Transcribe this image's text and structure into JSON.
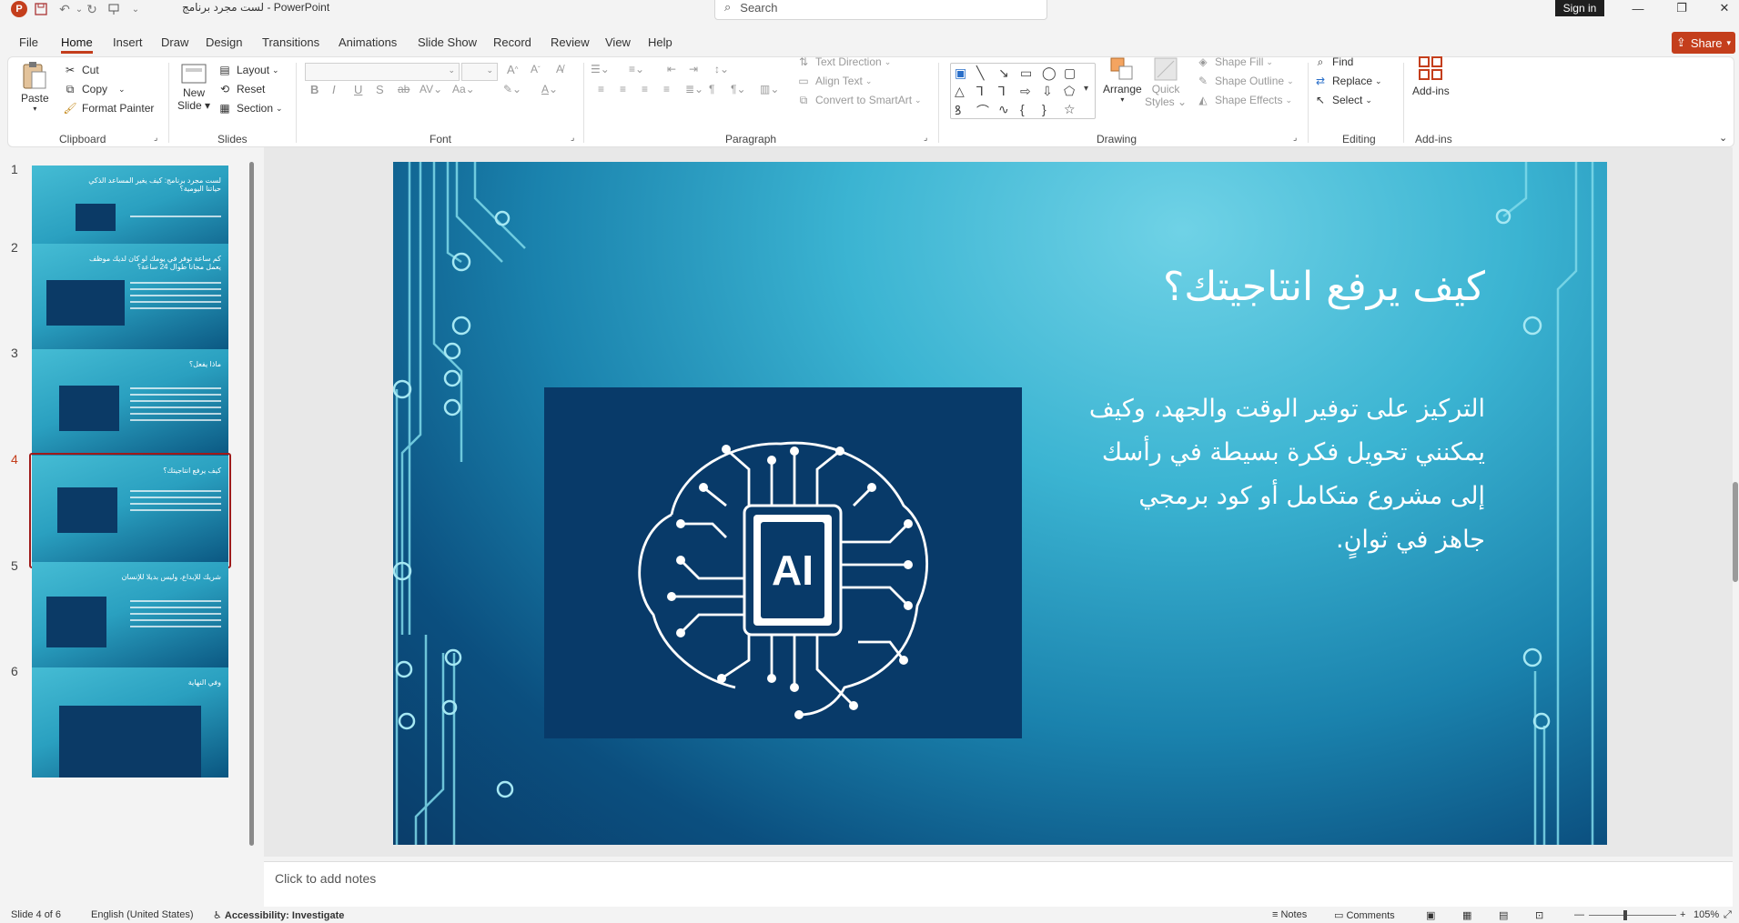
{
  "titlebar": {
    "doc_title": "لست مجرد برنامج",
    "separator": "-",
    "app_name": "PowerPoint",
    "search_placeholder": "Search",
    "sign_in": "Sign in"
  },
  "menu": [
    "File",
    "Home",
    "Insert",
    "Draw",
    "Design",
    "Transitions",
    "Animations",
    "Slide Show",
    "Record",
    "Review",
    "View",
    "Help"
  ],
  "active_menu": "Home",
  "share_label": "Share",
  "ribbon": {
    "clipboard": {
      "paste": "Paste",
      "cut": "Cut",
      "copy": "Copy",
      "format_painter": "Format Painter",
      "label": "Clipboard"
    },
    "slides": {
      "new_slide_1": "New",
      "new_slide_2": "Slide",
      "layout": "Layout",
      "reset": "Reset",
      "section": "Section",
      "label": "Slides"
    },
    "font": {
      "label": "Font"
    },
    "paragraph": {
      "text_direction": "Text Direction",
      "align_text": "Align Text",
      "convert_smartart": "Convert to SmartArt",
      "label": "Paragraph"
    },
    "drawing": {
      "arrange": "Arrange",
      "quick_styles_1": "Quick",
      "quick_styles_2": "Styles",
      "shape_fill": "Shape Fill",
      "shape_outline": "Shape Outline",
      "shape_effects": "Shape Effects",
      "label": "Drawing"
    },
    "editing": {
      "find": "Find",
      "replace": "Replace",
      "select": "Select",
      "label": "Editing"
    },
    "addins": {
      "button": "Add-ins",
      "label": "Add-ins"
    }
  },
  "slides": [
    {
      "num": "1",
      "title": "لست مجرد برنامج: كيف يغير المساعد الذكي حياتنا اليومية؟"
    },
    {
      "num": "2",
      "title": "كم ساعة توفر في يومك لو كان لديك موظف يعمل مجانا طوال 24 ساعة؟"
    },
    {
      "num": "3",
      "title": "ماذا يفعل؟"
    },
    {
      "num": "4",
      "title": "كيف يرفع انتاجيتك؟"
    },
    {
      "num": "5",
      "title": "شريك للإبداع، وليس بديلا للإنسان"
    },
    {
      "num": "6",
      "title": "وفي النهاية"
    }
  ],
  "current_slide": {
    "title": "كيف يرفع انتاجيتك؟",
    "body": "التركيز على توفير الوقت والجهد، وكيف يمكنني تحويل فكرة بسيطة في رأسك إلى مشروع متكامل أو كود برمجي جاهز في ثوانٍ.",
    "image_label": "AI"
  },
  "notes_placeholder": "Click to add notes",
  "status": {
    "slide_of": "Slide 4 of 6",
    "language": "English (United States)",
    "accessibility": "Accessibility: Investigate",
    "notes": "Notes",
    "comments": "Comments",
    "zoom": "105%"
  },
  "colors": {
    "accent": "#c43e1c",
    "slide_dark": "#083a69",
    "slide_light": "#45bcd4"
  }
}
